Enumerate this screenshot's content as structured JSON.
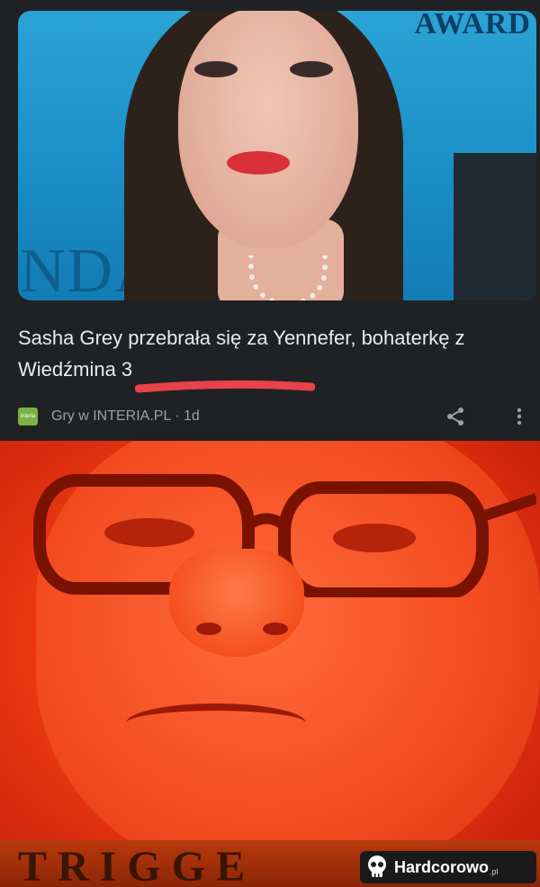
{
  "card": {
    "headline": "Sasha Grey przebrała się za Yennefer, bohaterkę z Wiedźmina 3",
    "source_logo_text": "interia",
    "source": "Gry w INTERIA.PL · 1d",
    "share_icon": "share-icon",
    "more_icon": "more-vert-icon",
    "photo_backdrop_text": "NDA",
    "photo_award_text": "AWARD"
  },
  "meme": {
    "caption": "TRIGGE",
    "watermark": "Hardcorowo",
    "watermark_suffix": ".pl"
  },
  "colors": {
    "card_bg": "#202124",
    "headline": "#e8eaed",
    "meta": "#9aa0a6",
    "underline": "#e8424a",
    "meme_red": "#ef3a14"
  }
}
